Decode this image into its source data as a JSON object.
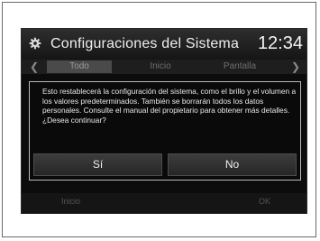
{
  "header": {
    "title": "Configuraciones del Sistema",
    "clock": "12:34",
    "icon": "gear-icon"
  },
  "tabs": [
    {
      "label": "Todo",
      "active": true
    },
    {
      "label": "Inicio",
      "active": false
    },
    {
      "label": "Pantalla",
      "active": false
    }
  ],
  "dialog": {
    "message": "Esto restablecerá la configuración del sistema, como el brillo y el volumen a los valores predeterminados. También se borrarán todos los datos personales. Consulte el manual del propietario para obtener más detalles. ¿Desea continuar?",
    "yes_label": "Sí",
    "no_label": "No"
  },
  "bottom": {
    "home_label": "Inicio",
    "ok_label": "OK"
  },
  "colors": {
    "screen_bg": "#0c0c0c",
    "dialog_border": "#b8b8b8",
    "text": "#e8e8e8"
  }
}
